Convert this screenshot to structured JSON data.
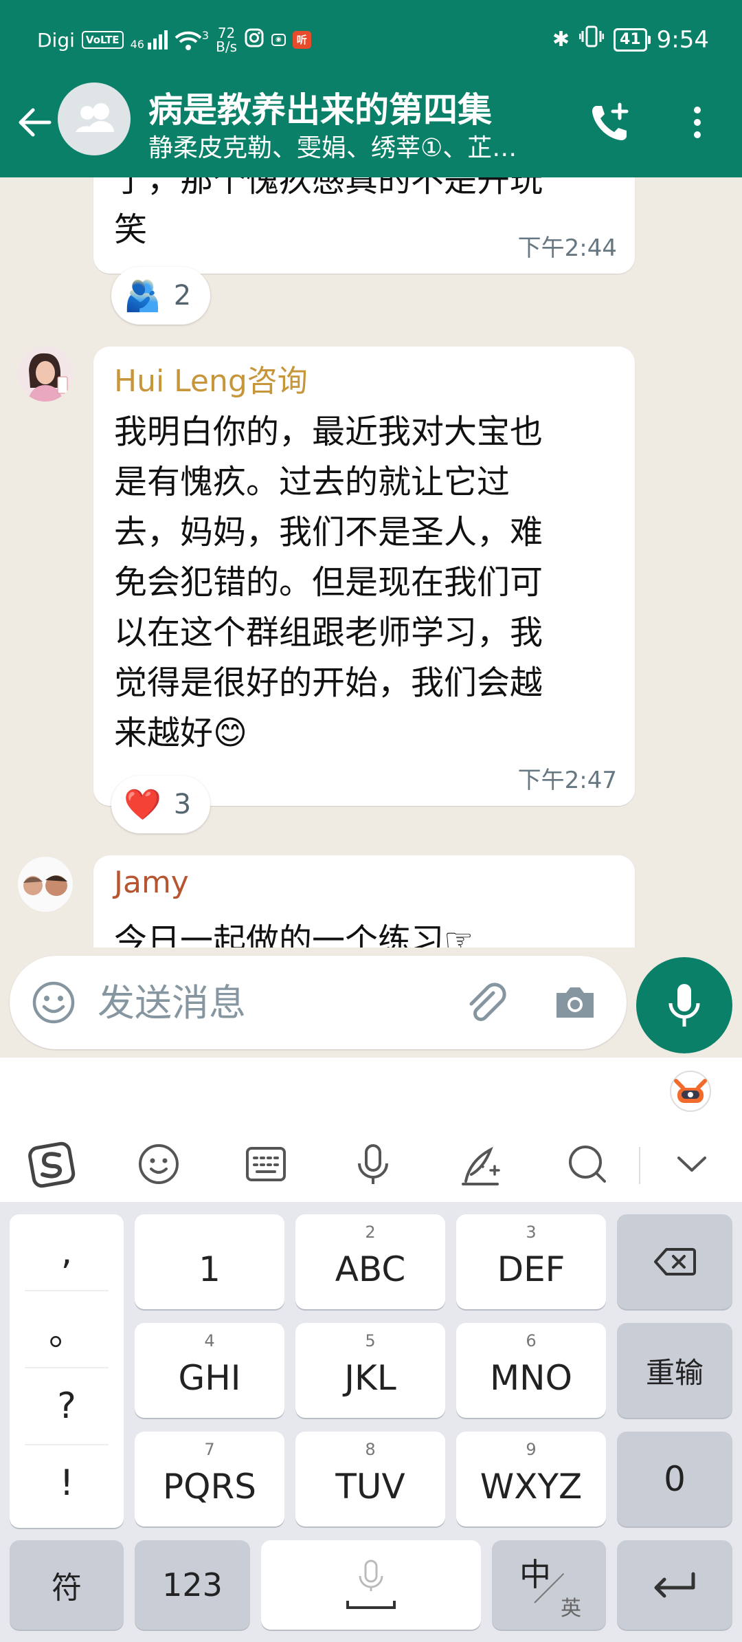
{
  "status_bar": {
    "carrier": "Digi",
    "volte": "VoLTE",
    "network": "46",
    "wifi_level": "3",
    "speed_value": "72",
    "speed_unit": "B/s",
    "app_badge": "听",
    "battery": "41",
    "time": "9:54"
  },
  "header": {
    "title": "病是教养出来的第四集",
    "subtitle": "静柔皮克勒、雯娟、绣莘①、芷…"
  },
  "messages": [
    {
      "id": "m1",
      "sender": "",
      "text_line1": "了，那个愧疚感真的不是开玩",
      "text_line2": "笑",
      "time": "下午2:44",
      "reaction": {
        "emoji": "🫂",
        "count": "2"
      }
    },
    {
      "id": "m2",
      "sender": "Hui Leng咨询",
      "sender_color": "#c7953a",
      "lines": [
        "我明白你的，最近我对大宝也",
        "是有愧疚。过去的就让它过",
        "去，妈妈，我们不是圣人，难",
        "免会犯错的。但是现在我们可",
        "以在这个群组跟老师学习，我",
        "觉得是很好的开始，我们会越",
        "来越好😊"
      ],
      "time": "下午2:47",
      "reaction": {
        "emoji": "❤️",
        "count": "3"
      }
    },
    {
      "id": "m3",
      "sender": "Jamy",
      "sender_color": "#b6552f",
      "text": "今日一起做的一个练习☞"
    }
  ],
  "composer": {
    "placeholder": "发送消息"
  },
  "keyboard": {
    "punctuation": [
      ",",
      "。",
      "?",
      "!"
    ],
    "rows": [
      [
        {
          "num": "",
          "label": "1"
        },
        {
          "num": "2",
          "label": "ABC"
        },
        {
          "num": "3",
          "label": "DEF"
        }
      ],
      [
        {
          "num": "4",
          "label": "GHI"
        },
        {
          "num": "5",
          "label": "JKL"
        },
        {
          "num": "6",
          "label": "MNO"
        }
      ],
      [
        {
          "num": "7",
          "label": "PQRS"
        },
        {
          "num": "8",
          "label": "TUV"
        },
        {
          "num": "9",
          "label": "WXYZ"
        }
      ]
    ],
    "reinput": "重输",
    "zero": "0",
    "symbols": "符",
    "numbers": "123",
    "lang_main": "中",
    "lang_sub": "英"
  },
  "colors": {
    "primary": "#0b8068",
    "chat_bg": "#efeae2"
  }
}
